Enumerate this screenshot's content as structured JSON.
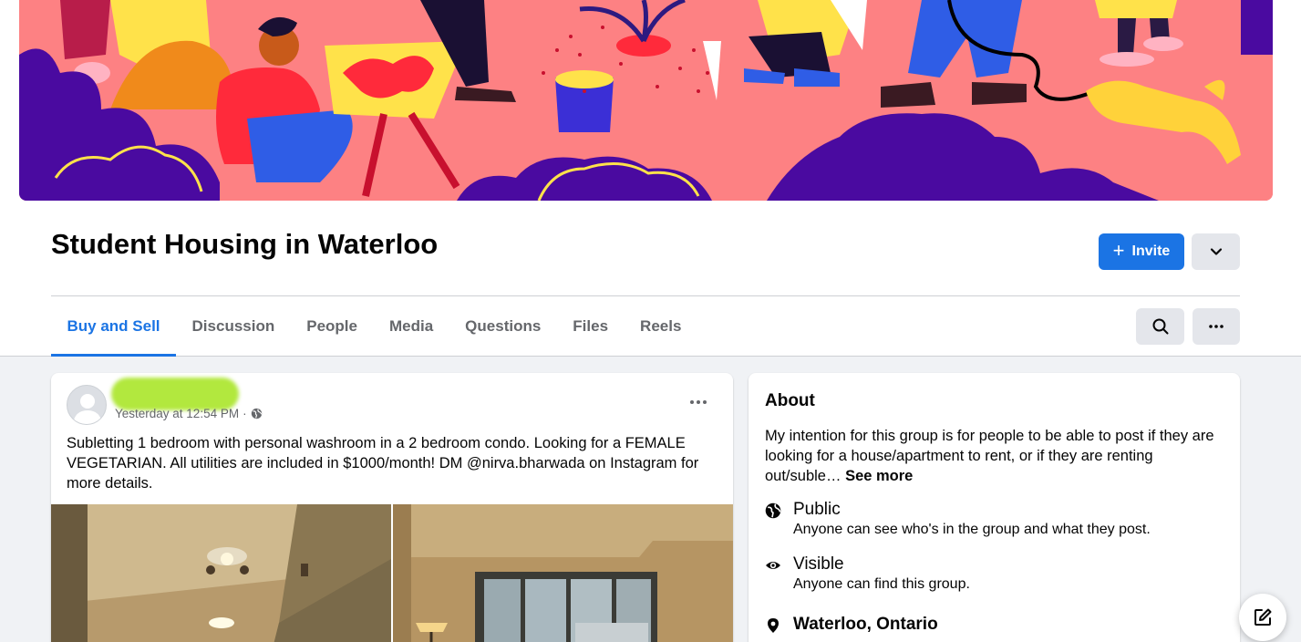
{
  "group": {
    "title": "Student Housing in Waterloo",
    "invite_label": "Invite"
  },
  "tabs": [
    {
      "label": "Buy and Sell",
      "active": true
    },
    {
      "label": "Discussion"
    },
    {
      "label": "People"
    },
    {
      "label": "Media"
    },
    {
      "label": "Questions"
    },
    {
      "label": "Files"
    },
    {
      "label": "Reels"
    }
  ],
  "post": {
    "timestamp": "Yesterday at 12:54 PM",
    "separator": "·",
    "audience_icon": "globe-icon",
    "text": "Subletting 1 bedroom with personal washroom in a 2 bedroom condo. Looking for a FEMALE VEGETARIAN. All utilities are included in $1000/month! DM @nirva.bharwada on Instagram for more details."
  },
  "about": {
    "title": "About",
    "description": "My intention for this group is for people to be able to post if they are looking for a house/apartment to rent, or if they are renting out/suble…",
    "see_more": "See more",
    "privacy": {
      "label": "Public",
      "sub": "Anyone can see who's in the group and what they post.",
      "icon": "globe-icon"
    },
    "visibility": {
      "label": "Visible",
      "sub": "Anyone can find this group.",
      "icon": "eye-icon"
    },
    "location": {
      "label": "Waterloo, Ontario",
      "icon": "location-pin-icon"
    }
  },
  "colors": {
    "accent": "#1b74e4",
    "cover_bg": "#fd8183"
  }
}
